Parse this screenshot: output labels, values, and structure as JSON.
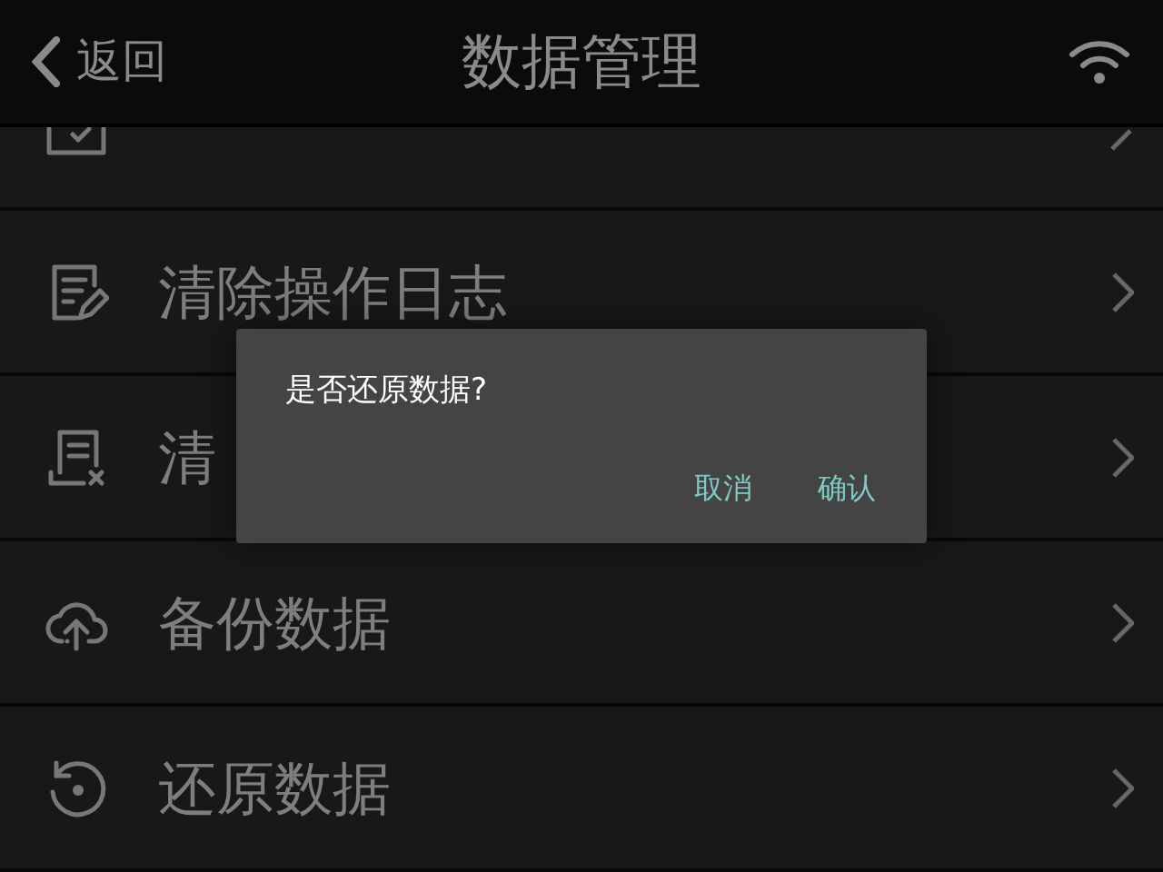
{
  "header": {
    "back_label": "返回",
    "title": "数据管理"
  },
  "items": [
    {
      "kind": "partial"
    },
    {
      "kind": "full",
      "label": "清除操作日志"
    },
    {
      "kind": "full",
      "label": "清"
    },
    {
      "kind": "full",
      "label": "备份数据"
    },
    {
      "kind": "full",
      "label": "还原数据"
    }
  ],
  "dialog": {
    "message": "是否还原数据?",
    "buttons": [
      "取消",
      "确认"
    ]
  }
}
